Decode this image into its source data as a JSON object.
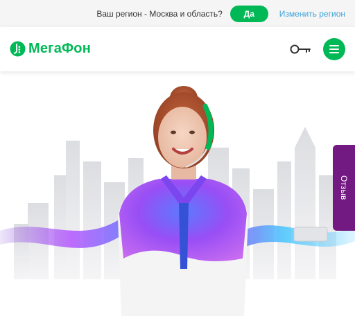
{
  "region_bar": {
    "question": "Ваш регион - Москва и область?",
    "confirm_label": "Да",
    "change_label": "Изменить регион"
  },
  "header": {
    "logo_text": "МегаФон",
    "key_icon": "key-icon",
    "menu_icon": "hamburger-menu-icon"
  },
  "feedback": {
    "label": "Отзыв"
  },
  "colors": {
    "brand_green": "#00b956",
    "brand_purple": "#731982",
    "link_blue": "#3fa3d8"
  }
}
